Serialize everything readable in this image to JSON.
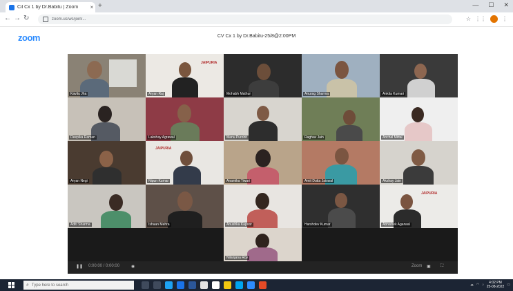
{
  "browser": {
    "tab_title": "Cil Cx 1 by Dr.Babitu | Zoom",
    "url": "zoom.us/wc/join/...",
    "new_tab_symbol": "+",
    "close_symbol": "×"
  },
  "zoom": {
    "logo": "zoom",
    "meeting_title": "CV Cx 1 by Dr.Babitu-25/8@2:00PM"
  },
  "participants": [
    {
      "name": "Kavitu Jha"
    },
    {
      "name": "Aryan Raj"
    },
    {
      "name": "Mohabh Mathur"
    },
    {
      "name": "Anurag Sharma"
    },
    {
      "name": "Ankita Kumari"
    },
    {
      "name": "Deepika Raman"
    },
    {
      "name": "Lakshay Agrawal"
    },
    {
      "name": "Manu Purohit"
    },
    {
      "name": "Raghav Jain"
    },
    {
      "name": "Anchal Mittal"
    },
    {
      "name": "Aryan Negi"
    },
    {
      "name": "Nipun Kumar"
    },
    {
      "name": "Anamika Tiwari"
    },
    {
      "name": "Amit Dutta Jaiswal"
    },
    {
      "name": "Akshay Jain"
    },
    {
      "name": "Aditi Sharma"
    },
    {
      "name": "Ishaan Mehra"
    },
    {
      "name": "Anushka Kapoor"
    },
    {
      "name": "Harshdev Kumar"
    },
    {
      "name": "Abhishek Agarwal"
    },
    {
      "name": "Nilanjana Roy"
    }
  ],
  "sign_text": "JAIPURIA",
  "controls": {
    "play_symbol": "❚❚",
    "time_text": "0:00:00 / 0:00:00",
    "cc_label": "Zoom"
  },
  "taskbar": {
    "search_placeholder": "Type here to search",
    "time": "4:02 PM",
    "date": "25-08-2022"
  },
  "colors": {
    "zoom_blue": "#2d8cff",
    "taskbar": "#1c2534",
    "stage": "#1a1a1a"
  }
}
